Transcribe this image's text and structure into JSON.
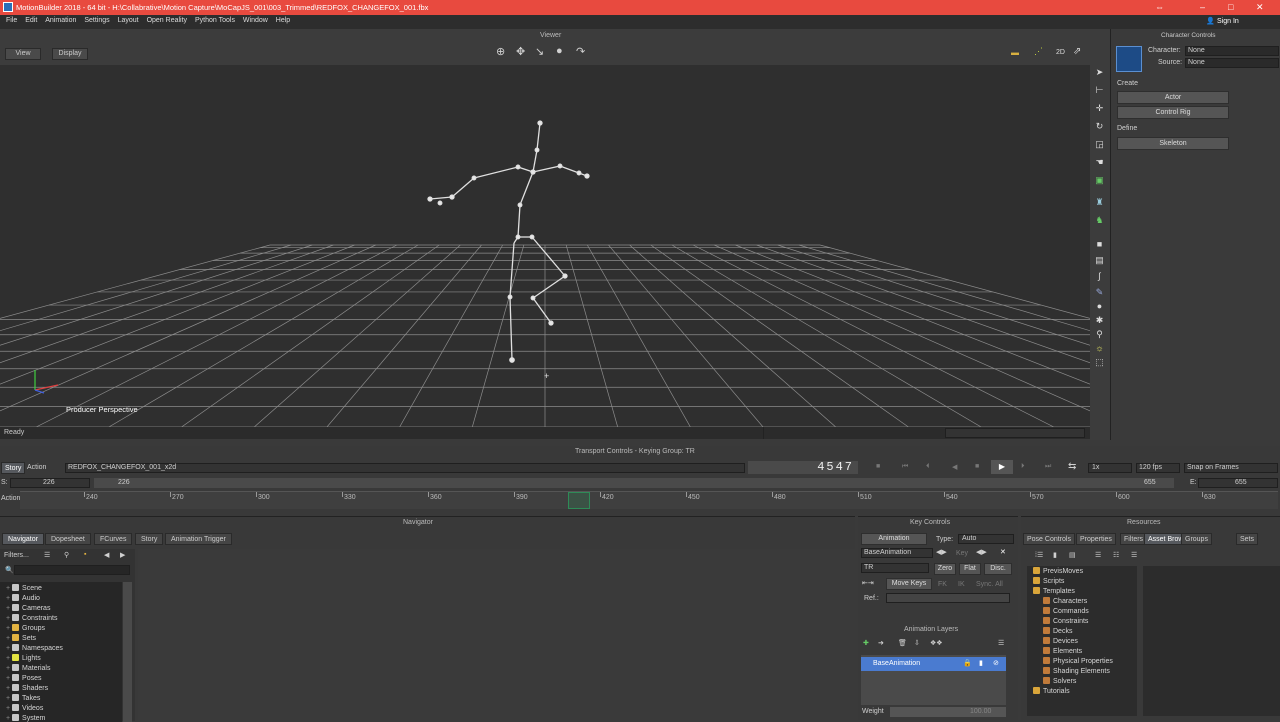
{
  "app": {
    "title": "MotionBuilder 2018 - 64 bit - H:\\Collabrative\\Motion Capture\\MoCapJS_001\\003_Trimmed\\REDFOX_CHANGEFOX_001.fbx",
    "sign_in": "Sign In"
  },
  "menu": [
    "File",
    "Edit",
    "Animation",
    "Settings",
    "Layout",
    "Open Reality",
    "Python Tools",
    "Window",
    "Help"
  ],
  "viewer": {
    "title": "Viewer",
    "view_btn": "View",
    "display_btn": "Display",
    "camera_label": "Producer Perspective",
    "status": "Ready",
    "mode_2d": "2D"
  },
  "character_controls": {
    "title": "Character Controls",
    "character_label": "Character:",
    "character_value": "None",
    "source_label": "Source:",
    "source_value": "None",
    "create_label": "Create",
    "actor_btn": "Actor",
    "control_rig_btn": "Control Rig",
    "define_label": "Define",
    "skeleton_btn": "Skeleton"
  },
  "transport": {
    "title": "Transport Controls  -  Keying Group: TR",
    "story_tab": "Story",
    "action_tab": "Action",
    "take_name": "REDFOX_CHANGEFOX_001_x2d",
    "frame": "4547",
    "speed": "1x",
    "fps": "120 fps",
    "snap": "Snap on Frames",
    "s_label": "S:",
    "s_value": "226",
    "current": "226",
    "e_label": "E:",
    "e_value": "655",
    "end_value": "655",
    "action_label": "Action",
    "ticks": [
      "240",
      "270",
      "300",
      "330",
      "360",
      "390",
      "420",
      "450",
      "480",
      "510",
      "540",
      "570",
      "600",
      "630"
    ]
  },
  "navigator": {
    "title": "Navigator",
    "tabs": [
      "Navigator",
      "Dopesheet",
      "FCurves",
      "Story",
      "Animation Trigger"
    ],
    "filters": "Filters...",
    "tree": [
      "Scene",
      "Audio",
      "Cameras",
      "Constraints",
      "Groups",
      "Sets",
      "Namespaces",
      "Lights",
      "Materials",
      "Poses",
      "Shaders",
      "Takes",
      "Videos",
      "System"
    ]
  },
  "key_controls": {
    "title": "Key Controls",
    "animation_btn": "Animation",
    "type_label": "Type:",
    "type_value": "Auto",
    "layer_value": "BaseAnimation",
    "key_btn": "Key",
    "tr_value": "TR",
    "zero_btn": "Zero",
    "flat_btn": "Flat",
    "disc_btn": "Disc.",
    "move_keys_btn": "Move Keys",
    "fk_btn": "FK",
    "ik_btn": "IK",
    "sync_btn": "Sync. All",
    "ref_label": "Ref.:",
    "layers_title": "Animation Layers",
    "base_layer": "BaseAnimation",
    "weight_label": "Weight",
    "weight_value": "100.00"
  },
  "resources": {
    "title": "Resources",
    "tabs": [
      "Pose Controls",
      "Properties",
      "Filters",
      "Asset Browser",
      "Groups",
      "Sets"
    ],
    "tree": [
      {
        "label": "PrevisMoves",
        "level": 1
      },
      {
        "label": "Scripts",
        "level": 1
      },
      {
        "label": "Templates",
        "level": 1
      },
      {
        "label": "Characters",
        "level": 2
      },
      {
        "label": "Commands",
        "level": 2
      },
      {
        "label": "Constraints",
        "level": 2
      },
      {
        "label": "Decks",
        "level": 2
      },
      {
        "label": "Devices",
        "level": 2
      },
      {
        "label": "Elements",
        "level": 2
      },
      {
        "label": "Physical Properties",
        "level": 2
      },
      {
        "label": "Shading Elements",
        "level": 2
      },
      {
        "label": "Solvers",
        "level": 2
      },
      {
        "label": "Tutorials",
        "level": 1
      }
    ]
  },
  "colors": {
    "title_bar": "#e84a3f",
    "accent": "#4a7bd0",
    "viewport": "#2f2f2f",
    "grid": "#8a8a8a"
  }
}
